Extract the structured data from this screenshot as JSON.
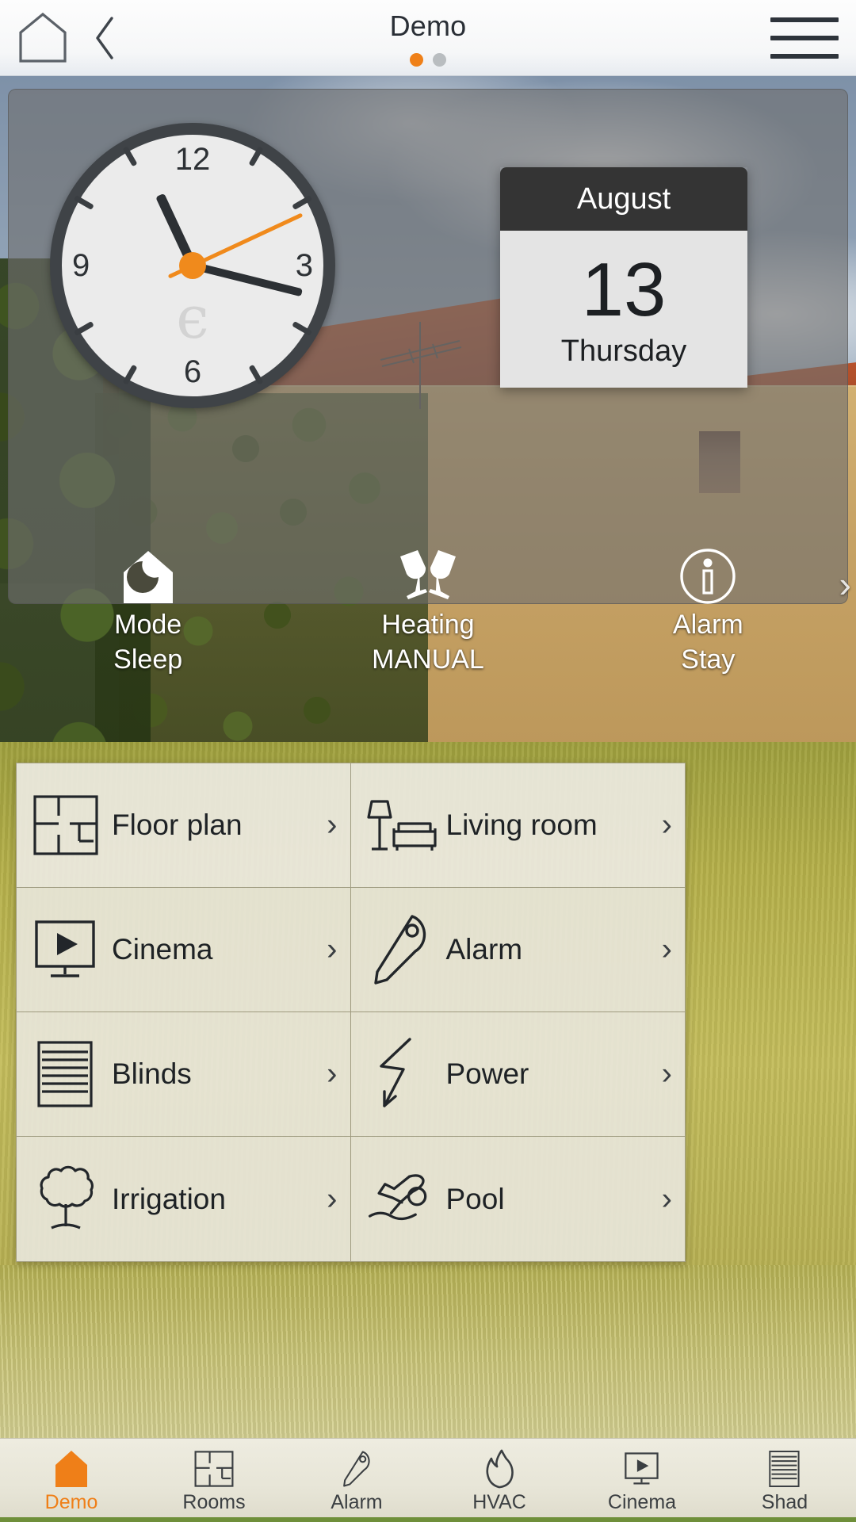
{
  "topbar": {
    "home_icon": "home-outline-icon",
    "back_icon": "chevron-left-icon",
    "title": "Demo",
    "menu_icon": "hamburger-menu-icon",
    "pages": [
      {
        "active": true
      },
      {
        "active": false
      }
    ],
    "active_dot_color": "#ef8018",
    "inactive_dot_color": "#b9bdc0"
  },
  "clock": {
    "numerals": {
      "twelve": "12",
      "three": "3",
      "six": "6",
      "nine": "9"
    },
    "hour_angle_deg": 335,
    "minute_angle_deg": 104,
    "second_angle_deg": 65,
    "second_hand_color": "#f08a1c",
    "hand_color": "#2c3034",
    "bezel_color": "#3f4347",
    "face_color": "#ebebeb"
  },
  "calendar": {
    "month": "August",
    "day": "13",
    "weekday": "Thursday",
    "header_color": "#343434",
    "body_color": "#e4e4e4"
  },
  "status": {
    "next_icon": "chevron-right-icon",
    "items": [
      {
        "icon": "house-moon-icon",
        "label": "Mode",
        "value": "Sleep"
      },
      {
        "icon": "cheers-glasses-icon",
        "label": "Heating",
        "value": "MANUAL"
      },
      {
        "icon": "info-circle-icon",
        "label": "Alarm",
        "value": "Stay"
      }
    ]
  },
  "menu": {
    "chevron_icon": "chevron-right-icon",
    "items": [
      {
        "icon": "floor-plan-icon",
        "label": "Floor plan"
      },
      {
        "icon": "living-room-icon",
        "label": "Living room"
      },
      {
        "icon": "cinema-screen-icon",
        "label": "Cinema"
      },
      {
        "icon": "key-icon",
        "label": "Alarm"
      },
      {
        "icon": "blinds-icon",
        "label": "Blinds"
      },
      {
        "icon": "lightning-bolt-icon",
        "label": "Power"
      },
      {
        "icon": "tree-icon",
        "label": "Irrigation"
      },
      {
        "icon": "swimmer-icon",
        "label": "Pool"
      }
    ]
  },
  "tabbar": {
    "active_color": "#ef7f18",
    "tabs": [
      {
        "icon": "home-filled-icon",
        "label": "Demo",
        "active": true
      },
      {
        "icon": "floor-plan-icon",
        "label": "Rooms",
        "active": false
      },
      {
        "icon": "key-icon",
        "label": "Alarm",
        "active": false
      },
      {
        "icon": "flame-icon",
        "label": "HVAC",
        "active": false
      },
      {
        "icon": "cinema-screen-icon",
        "label": "Cinema",
        "active": false
      },
      {
        "icon": "blinds-icon",
        "label": "Shad",
        "active": false
      }
    ]
  }
}
